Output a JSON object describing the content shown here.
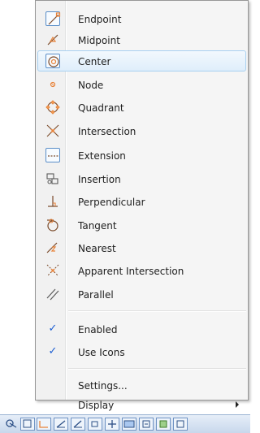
{
  "menu": {
    "snap_items": [
      {
        "label": "Endpoint",
        "icon": "endpoint-icon",
        "boxed": true
      },
      {
        "label": "Midpoint",
        "icon": "midpoint-icon",
        "boxed": false
      },
      {
        "label": "Center",
        "icon": "center-icon",
        "boxed": true,
        "highlighted": true
      },
      {
        "label": "Node",
        "icon": "node-icon",
        "boxed": false
      },
      {
        "label": "Quadrant",
        "icon": "quadrant-icon",
        "boxed": false
      },
      {
        "label": "Intersection",
        "icon": "intersection-icon",
        "boxed": false
      },
      {
        "label": "Extension",
        "icon": "extension-icon",
        "boxed": true
      },
      {
        "label": "Insertion",
        "icon": "insertion-icon",
        "boxed": false
      },
      {
        "label": "Perpendicular",
        "icon": "perpendicular-icon",
        "boxed": false
      },
      {
        "label": "Tangent",
        "icon": "tangent-icon",
        "boxed": false
      },
      {
        "label": "Nearest",
        "icon": "nearest-icon",
        "boxed": false
      },
      {
        "label": "Apparent Intersection",
        "icon": "apparent-intersection-icon",
        "boxed": false
      },
      {
        "label": "Parallel",
        "icon": "parallel-icon",
        "boxed": false
      }
    ],
    "options": [
      {
        "label": "Enabled",
        "checked": true
      },
      {
        "label": "Use Icons",
        "checked": true
      }
    ],
    "settings_label": "Settings...",
    "display_label": "Display",
    "check_mark": "✓"
  },
  "colors": {
    "accent": "#1b5dd2",
    "highlight_border": "#a8d0f0",
    "icon_marker": "#e8833a"
  }
}
